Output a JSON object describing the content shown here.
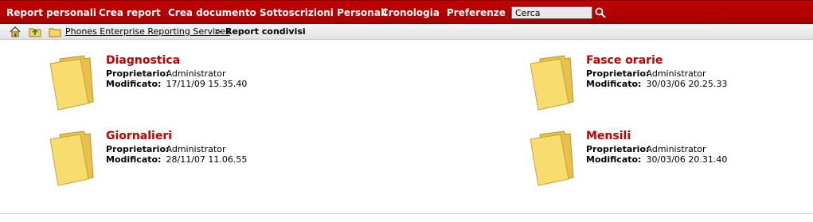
{
  "nav": {
    "items": [
      {
        "label": "Report personali"
      },
      {
        "label": "Crea report"
      },
      {
        "label": "Crea documento"
      },
      {
        "label": "Sottoscrizioni Personali"
      },
      {
        "label": "Cronologia"
      },
      {
        "label": "Preferenze"
      }
    ],
    "search_value": "Cerca",
    "search_icon": "magnifier-icon"
  },
  "breadcrumb": {
    "icons": [
      "home-icon",
      "up-folder-icon",
      "folder-icon"
    ],
    "link": "Phones Enterprise Reporting Services",
    "separator": ">",
    "current": "Report condivisi"
  },
  "folders": [
    {
      "name": "Diagnostica",
      "owner_label": "Proprietario:",
      "owner": "Administrator",
      "modified_label": "Modificato:",
      "modified": "17/11/09 15.35.40"
    },
    {
      "name": "Fasce orarie",
      "owner_label": "Proprietario:",
      "owner": "Administrator",
      "modified_label": "Modificato:",
      "modified": "30/03/06 20.25.33"
    },
    {
      "name": "Giornalieri",
      "owner_label": "Proprietario:",
      "owner": "Administrator",
      "modified_label": "Modificato:",
      "modified": "28/11/07 11.06.55"
    },
    {
      "name": "Mensili",
      "owner_label": "Proprietario:",
      "owner": "Administrator",
      "modified_label": "Modificato:",
      "modified": "30/03/06 20.31.40"
    }
  ],
  "colors": {
    "nav_bg": "#b30000",
    "title": "#c00000",
    "folder": "#f6d65c"
  }
}
